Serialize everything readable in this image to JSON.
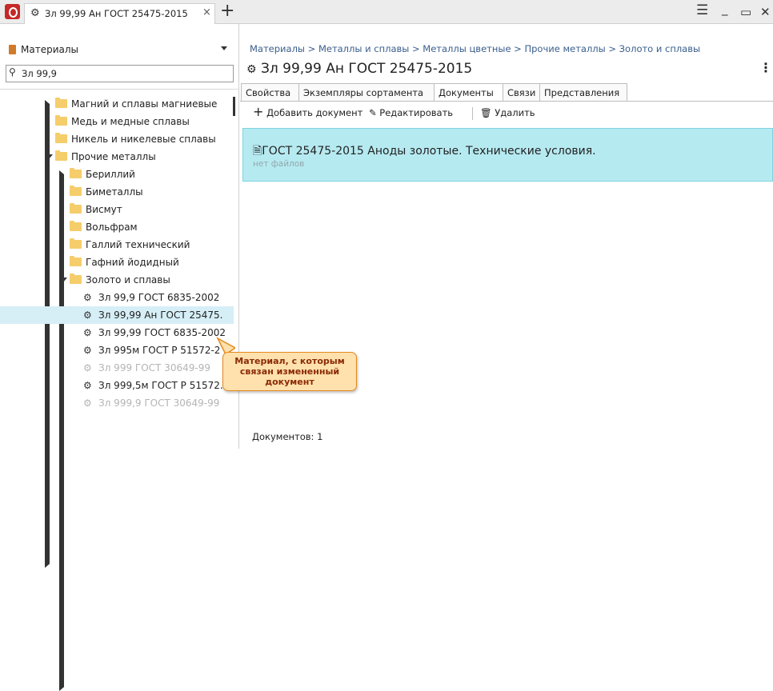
{
  "window": {
    "tab_title": "Зл 99,99 Ан ГОСТ 25475-2015",
    "tab_close": "×",
    "new_tab": "+",
    "controls": {
      "menu": "☰",
      "minimize": "_",
      "maximize": "▭",
      "close": "✕"
    }
  },
  "sidebar": {
    "selector_label": "Материалы",
    "search_value": "Зл 99,9",
    "tree": [
      {
        "label": "Магний и сплавы магниевые",
        "kind": "folder",
        "expanded": false,
        "level": 1
      },
      {
        "label": "Медь и медные сплавы",
        "kind": "folder",
        "expanded": false,
        "level": 1
      },
      {
        "label": "Никель и никелевые сплавы",
        "kind": "folder",
        "expanded": false,
        "level": 1
      },
      {
        "label": "Прочие металлы",
        "kind": "folder",
        "expanded": true,
        "level": 1
      },
      {
        "label": "Бериллий",
        "kind": "folder",
        "expanded": false,
        "level": 2
      },
      {
        "label": "Биметаллы",
        "kind": "folder",
        "expanded": false,
        "level": 2
      },
      {
        "label": "Висмут",
        "kind": "folder",
        "expanded": false,
        "level": 2
      },
      {
        "label": "Вольфрам",
        "kind": "folder",
        "expanded": false,
        "level": 2
      },
      {
        "label": "Галлий технический",
        "kind": "folder",
        "expanded": false,
        "level": 2
      },
      {
        "label": "Гафний йодидный",
        "kind": "folder",
        "expanded": false,
        "level": 2
      },
      {
        "label": "Золото и сплавы",
        "kind": "folder",
        "expanded": true,
        "level": 2
      },
      {
        "label": "Зл 99,9 ГОСТ 6835-2002",
        "kind": "material",
        "level": 3
      },
      {
        "label": "Зл 99,99 Ан ГОСТ 25475.",
        "kind": "material",
        "level": 3,
        "selected": true
      },
      {
        "label": "Зл 99,99 ГОСТ 6835-2002",
        "kind": "material",
        "level": 3
      },
      {
        "label": "Зл 995м ГОСТ Р 51572-2",
        "kind": "material",
        "level": 3
      },
      {
        "label": "Зл 999 ГОСТ 30649-99",
        "kind": "material",
        "level": 3,
        "dimmed": true
      },
      {
        "label": "Зл 999,5м ГОСТ Р 51572...",
        "kind": "material",
        "level": 3
      },
      {
        "label": "Зл 999,9 ГОСТ 30649-99",
        "kind": "material",
        "level": 3,
        "dimmed": true
      }
    ]
  },
  "main": {
    "breadcrumb": "Материалы > Металлы и сплавы > Металлы цветные > Прочие металлы > Золото и сплавы",
    "title": "Зл 99,99 Ан ГОСТ 25475-2015",
    "tabs": [
      "Свойства",
      "Экземпляры сортамента",
      "Документы",
      "Связи",
      "Представления"
    ],
    "active_tab": "Документы",
    "toolbar": {
      "add": "Добавить документ",
      "edit": "Редактировать",
      "delete": "Удалить"
    },
    "document": {
      "name": "ГОСТ 25475-2015 Аноды золотые. Технические условия.",
      "files": "нет файлов"
    },
    "count_label": "Документов: 1"
  },
  "callout": {
    "text": "Материал, с которым связан измененный документ"
  },
  "colors": {
    "selection": "#d6eef6",
    "doc_card": "#b6eaf1",
    "callout_bg": "#ffe1ad",
    "callout_border": "#e38a1e",
    "breadcrumb": "#3a5e8c"
  }
}
